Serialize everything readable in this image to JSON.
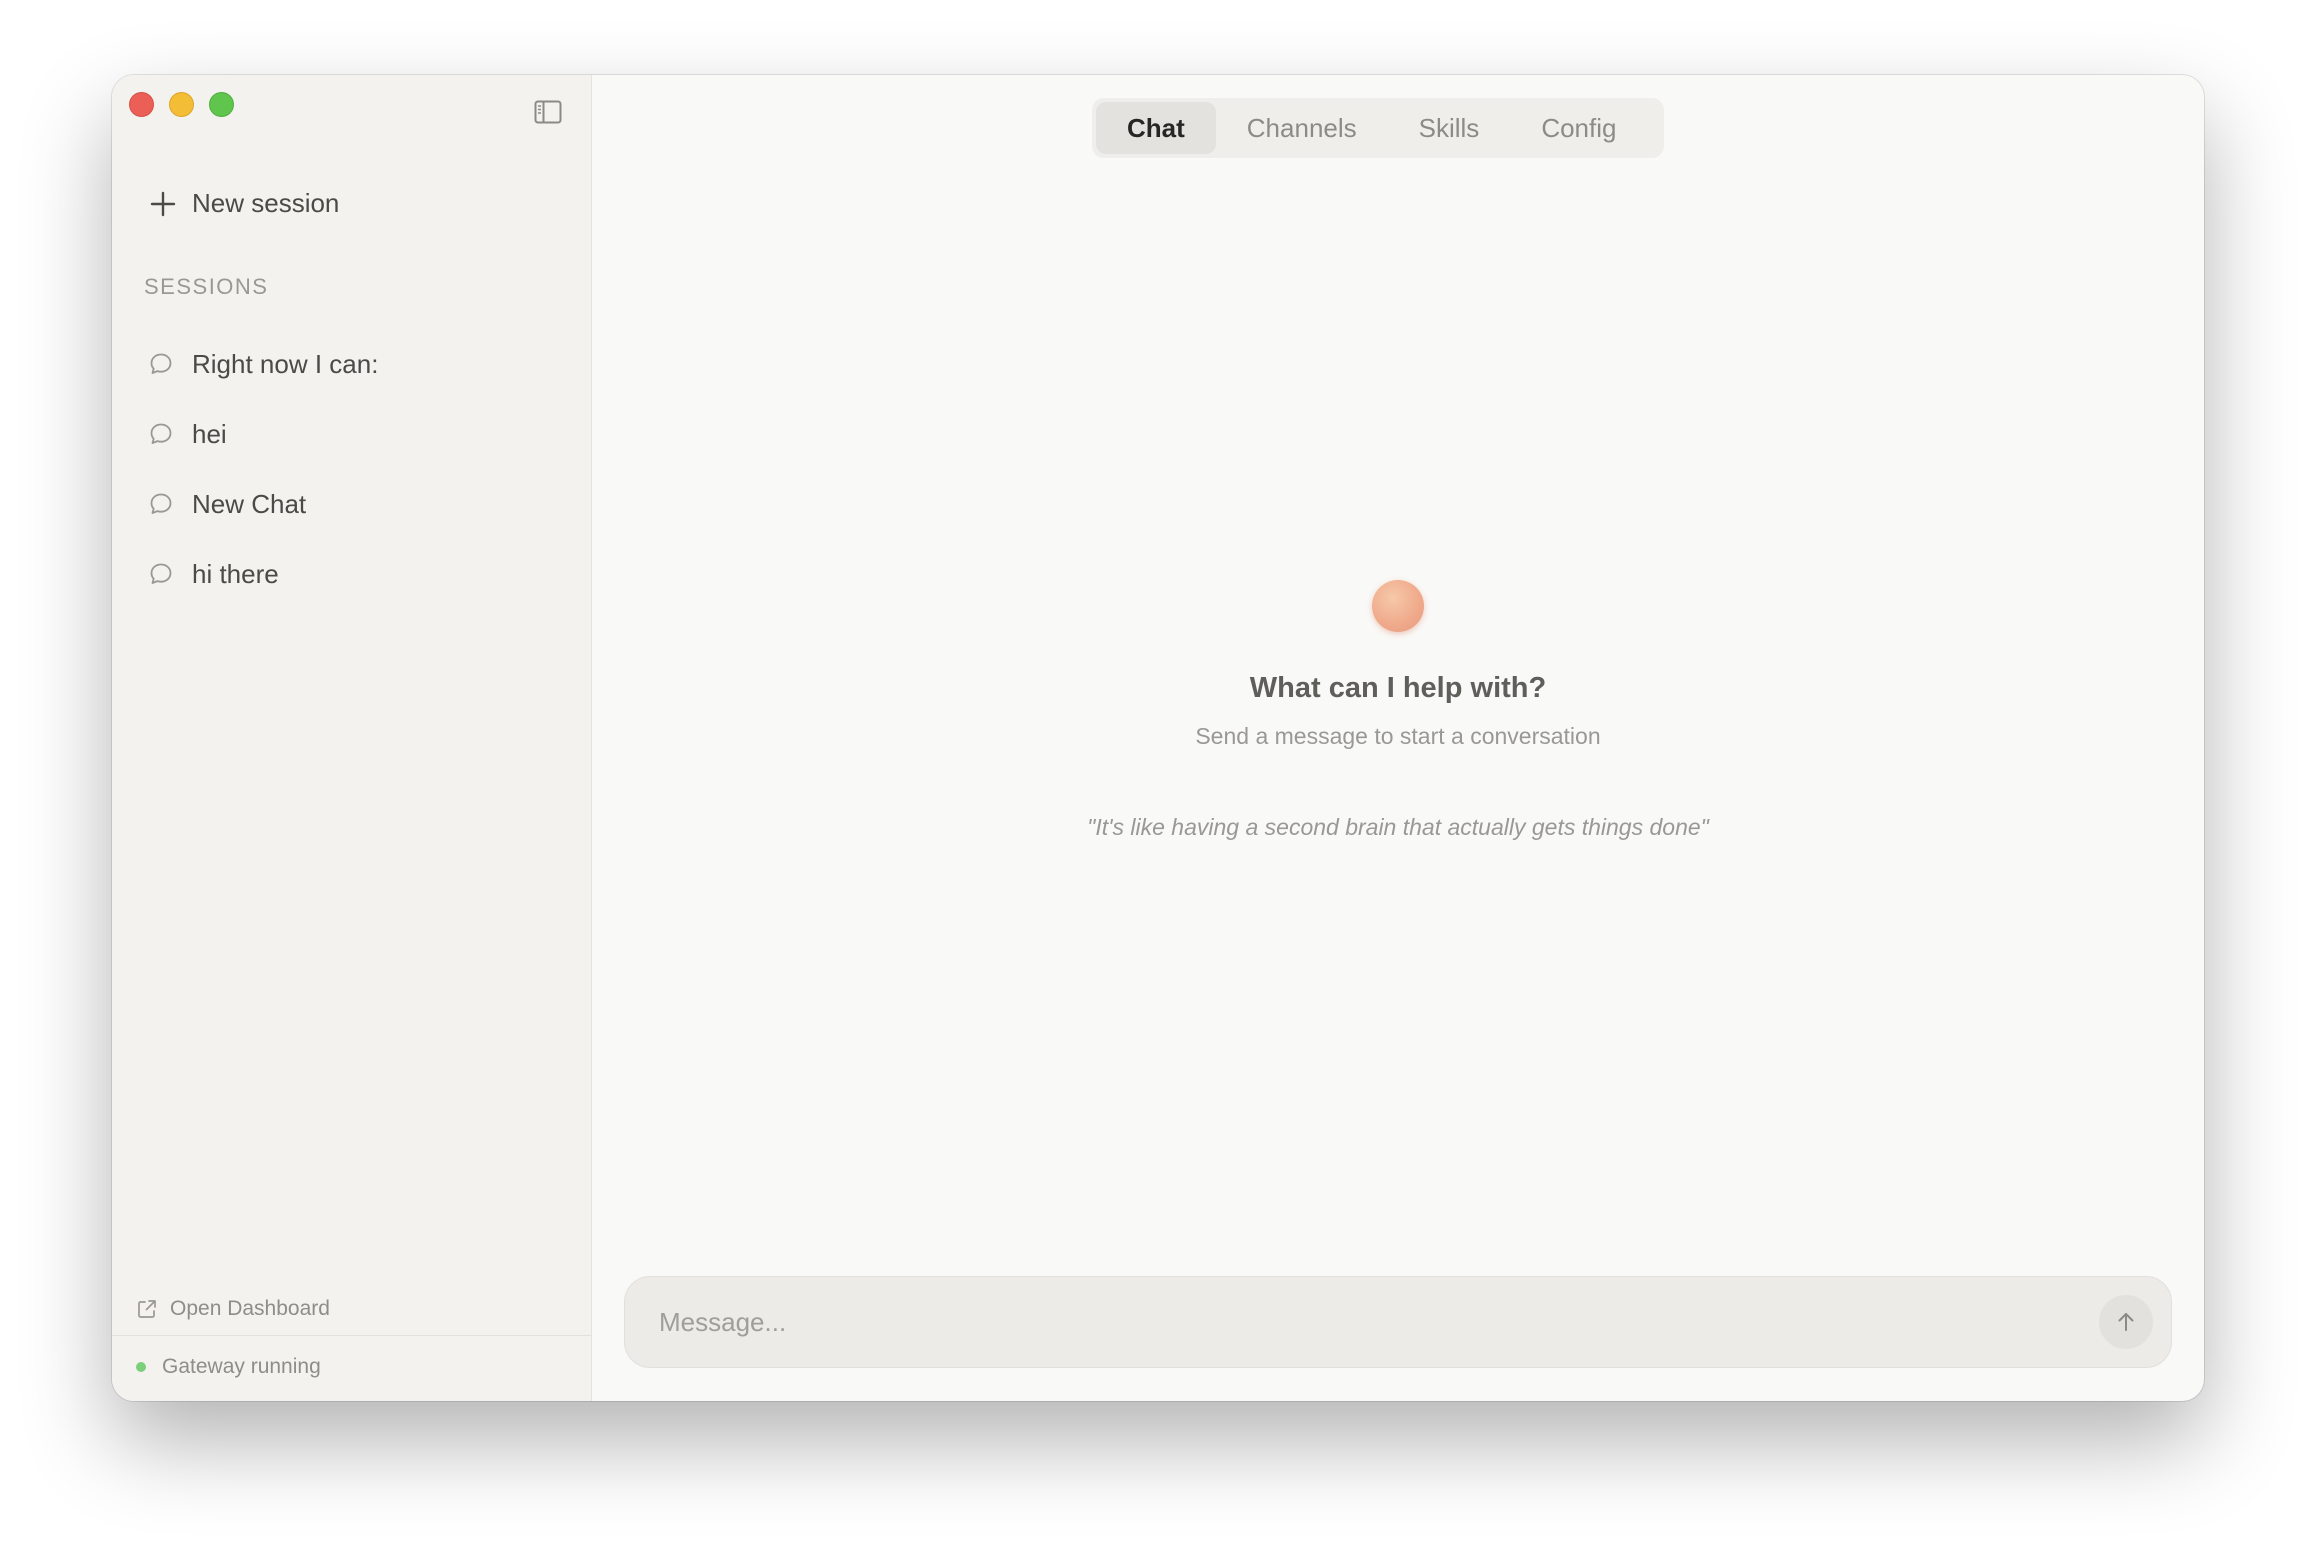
{
  "sidebar": {
    "new_session_label": "New session",
    "sessions_heading": "SESSIONS",
    "sessions": [
      {
        "title": "Right now I can:"
      },
      {
        "title": "hei"
      },
      {
        "title": "New Chat"
      },
      {
        "title": "hi there"
      }
    ],
    "open_dashboard_label": "Open Dashboard",
    "gateway_status": "Gateway running"
  },
  "tabs": [
    {
      "label": "Chat",
      "active": true
    },
    {
      "label": "Channels",
      "active": false
    },
    {
      "label": "Skills",
      "active": false
    },
    {
      "label": "Config",
      "active": false
    }
  ],
  "empty_state": {
    "title": "What can I help with?",
    "subtitle": "Send a message to start a conversation",
    "quote": "\"It's like having a second brain that actually gets things done\""
  },
  "composer": {
    "placeholder": "Message...",
    "value": ""
  },
  "icons": {
    "sidebar_toggle": "sidebar-toggle-icon",
    "new_session": "plus-icon",
    "session": "chat-bubble-icon",
    "open_dashboard": "external-link-icon",
    "send": "arrow-up-icon"
  },
  "colors": {
    "accent_orb": "#efa98a",
    "status_ok": "#7ccf7b",
    "close": "#ec5f57",
    "minimize": "#f4bd36",
    "maximize": "#5fc54c"
  }
}
